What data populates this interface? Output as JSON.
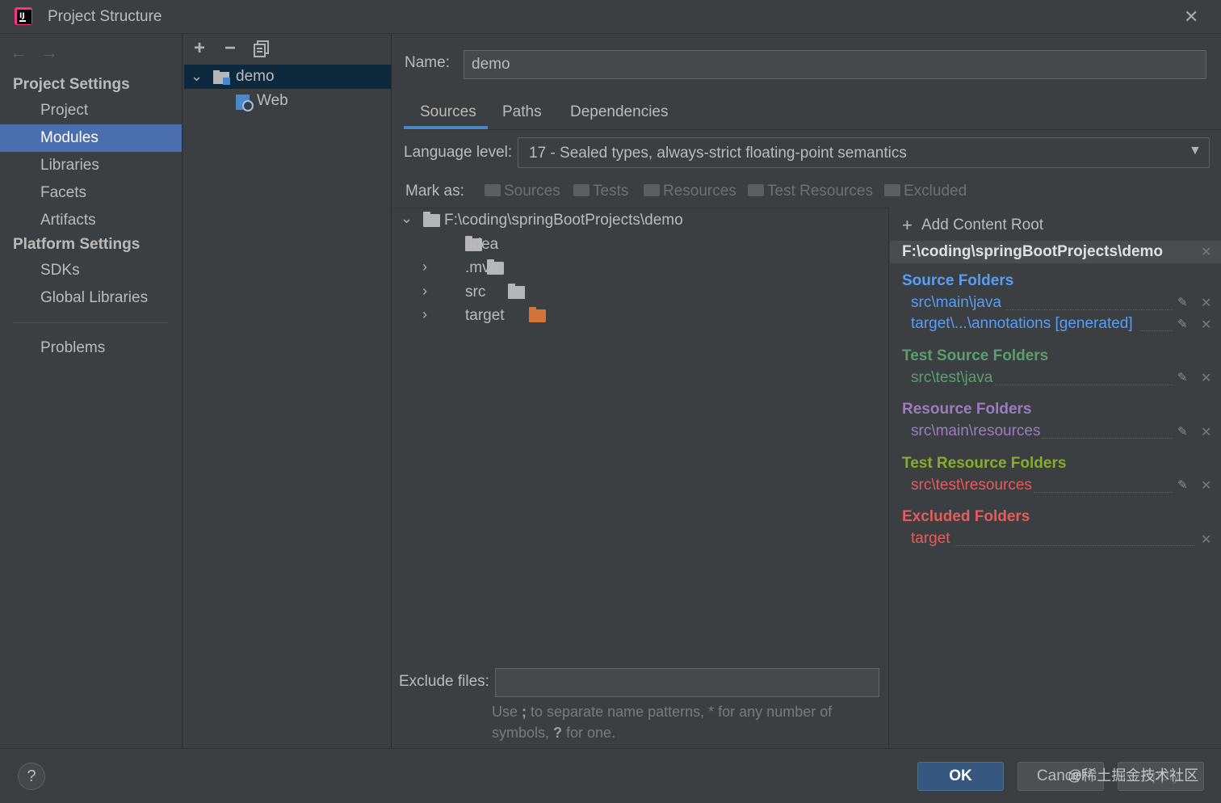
{
  "window": {
    "title": "Project Structure"
  },
  "nav": {
    "back_arrow": "←",
    "forward_arrow": "→",
    "project_settings_heading": "Project Settings",
    "project_items": [
      {
        "label": "Project"
      },
      {
        "label": "Modules",
        "selected": true
      },
      {
        "label": "Libraries"
      },
      {
        "label": "Facets"
      },
      {
        "label": "Artifacts"
      }
    ],
    "platform_settings_heading": "Platform Settings",
    "platform_items": [
      {
        "label": "SDKs"
      },
      {
        "label": "Global Libraries"
      }
    ],
    "problems_label": "Problems"
  },
  "module_tree": {
    "toolbar": {
      "add": "+",
      "remove": "−",
      "copy_icon": "copy-icon"
    },
    "module": "demo",
    "facet": "Web"
  },
  "module": {
    "name_label": "Name:",
    "name_value": "demo",
    "tabs": [
      "Sources",
      "Paths",
      "Dependencies"
    ],
    "active_tab": "Sources",
    "language_label": "Language level:",
    "language_value": "17 - Sealed types, always-strict floating-point semantics",
    "mark_as_label": "Mark as:",
    "mark_as_options": [
      "Sources",
      "Tests",
      "Resources",
      "Test Resources",
      "Excluded"
    ]
  },
  "file_tree": {
    "root": "F:\\coding\\springBootProjects\\demo",
    "children": [
      {
        "name": ".idea",
        "expandable": false,
        "color": "#b5b6b7"
      },
      {
        "name": ".mvn",
        "expandable": true,
        "color": "#b5b6b7"
      },
      {
        "name": "src",
        "expandable": true,
        "color": "#b5b6b7"
      },
      {
        "name": "target",
        "expandable": true,
        "color": "#d2743a"
      }
    ]
  },
  "content_roots": {
    "add_label": "Add Content Root",
    "root_path": "F:\\coding\\springBootProjects\\demo",
    "sections": [
      {
        "title": "Source Folders",
        "color": "#589df6",
        "items": [
          "src\\main\\java",
          "target\\...\\annotations [generated]"
        ]
      },
      {
        "title": "Test Source Folders",
        "color": "#5c9e6f",
        "items": [
          "src\\test\\java"
        ]
      },
      {
        "title": "Resource Folders",
        "color": "#9a7dbf",
        "items": [
          "src\\main\\resources"
        ]
      },
      {
        "title": "Test Resource Folders",
        "color": "#8aac29",
        "items": [
          "src\\test\\resources"
        ]
      },
      {
        "title": "Excluded Folders",
        "color": "#e65b5b",
        "items": [
          "target"
        ]
      }
    ],
    "item_colors": [
      "#589df6",
      "#5c9e6f",
      "#9a7dbf",
      "#e65b5b",
      "#e65b5b"
    ]
  },
  "exclude": {
    "label": "Exclude files:",
    "value": "",
    "hint_part1": "Use ",
    "hint_semicolon": ";",
    "hint_part2": " to separate name patterns, * for any number of symbols, ",
    "hint_q": "?",
    "hint_part3": " for one."
  },
  "buttons": {
    "help": "?",
    "ok": "OK",
    "cancel": "Cancel",
    "apply": "Apply"
  },
  "watermark": "@稀土掘金技术社区",
  "colors": {
    "accent": "#4b6eaf",
    "background": "#3c3f41",
    "ok_button": "#365880"
  }
}
